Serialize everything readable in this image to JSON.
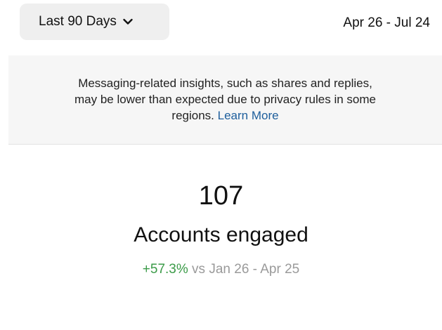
{
  "header": {
    "range_selector_label": "Last 90 Days",
    "date_range": "Apr 26 - Jul 24"
  },
  "notice": {
    "line1": "Messaging-related insights, such as shares and replies,",
    "line2": "may be lower than expected due to privacy rules in some",
    "line3_prefix": "regions. ",
    "learn_more_label": "Learn More",
    "link_color": "#1d5e9c"
  },
  "metric": {
    "value": "107",
    "label": "Accounts engaged",
    "delta": "+57.3%",
    "comparison_text": " vs Jan 26 - Apr 25",
    "delta_color": "#3b9b48"
  },
  "icons": {
    "range_chevron": "chevron-down-icon"
  }
}
